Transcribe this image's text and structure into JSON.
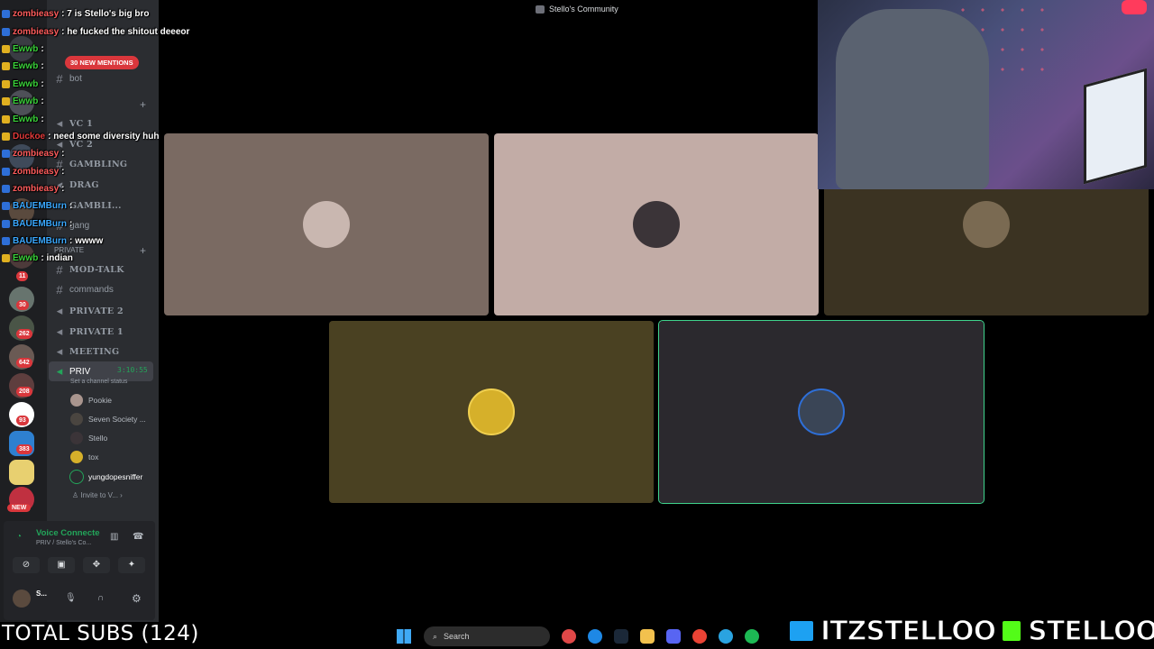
{
  "window": {
    "title": "Stello's Community"
  },
  "rail": {
    "badges": [
      "11",
      "30",
      "262",
      "642",
      "208",
      "93",
      "383"
    ],
    "new_label": "NEW"
  },
  "sidebar": {
    "mentions_pill": "30 NEW MENTIONS",
    "channels": [
      {
        "label": "bot",
        "type": "text",
        "bold": false
      },
      {
        "label": "VC 1",
        "type": "voice",
        "bold": true
      },
      {
        "label": "VC 2",
        "type": "voice",
        "bold": true
      },
      {
        "label": "GAMBLING",
        "type": "text",
        "bold": true
      },
      {
        "label": "DRAG",
        "type": "voice",
        "bold": true
      },
      {
        "label": "GAMBLI...",
        "type": "voice",
        "bold": true
      },
      {
        "label": "gang",
        "type": "text",
        "bold": false
      },
      {
        "label": "PRIVATE",
        "type": "category",
        "bold": false
      },
      {
        "label": "MOD-TALK",
        "type": "text",
        "bold": true
      },
      {
        "label": "commands",
        "type": "text",
        "bold": false
      },
      {
        "label": "PRIVATE 2",
        "type": "voice",
        "bold": true
      },
      {
        "label": "PRIVATE 1",
        "type": "voice",
        "bold": true
      },
      {
        "label": "MEETING",
        "type": "voice",
        "bold": true
      }
    ],
    "active_channel": {
      "label": "PRIV",
      "timer": "3:10:55",
      "status": "Set a channel status"
    },
    "voice_members": [
      "Pookie",
      "Seven Society ...",
      "Stello",
      "tox",
      "yungdopesniffer"
    ],
    "invite_label": "Invite to V..."
  },
  "voice_panel": {
    "title": "Voice Connecte",
    "subtitle": "PRIV / Stello's Co...",
    "user_name": "S..."
  },
  "chat": [
    {
      "user": "zombieasy",
      "msg": " : 7 is Stello's big bro",
      "color": "#ff5c5c",
      "badge": "#2e6fd8"
    },
    {
      "user": "zombieasy",
      "msg": " : he fucked the shitout deeeor",
      "color": "#ff5c5c",
      "badge": "#2e6fd8"
    },
    {
      "user": "Ewwb",
      "msg": " :",
      "color": "#3ad13a",
      "badge": "#e0b020"
    },
    {
      "user": "Ewwb",
      "msg": " :",
      "color": "#3ad13a",
      "badge": "#e0b020"
    },
    {
      "user": "Ewwb",
      "msg": " :",
      "color": "#3ad13a",
      "badge": "#e0b020"
    },
    {
      "user": "Ewwb",
      "msg": " :",
      "color": "#3ad13a",
      "badge": "#e0b020"
    },
    {
      "user": "Ewwb",
      "msg": " :",
      "color": "#3ad13a",
      "badge": "#e0b020"
    },
    {
      "user": "Duckoe",
      "msg": " : need some diversity huh",
      "color": "#e23a3a",
      "badge": "#e0b020"
    },
    {
      "user": "zombieasy",
      "msg": " :",
      "color": "#ff5c5c",
      "badge": "#2e6fd8"
    },
    {
      "user": "zombieasy",
      "msg": " :",
      "color": "#ff5c5c",
      "badge": "#2e6fd8"
    },
    {
      "user": "zombieasy",
      "msg": " :",
      "color": "#ff5c5c",
      "badge": "#2e6fd8"
    },
    {
      "user": "BAUEMBurn",
      "msg": " :",
      "color": "#3aa8ff",
      "badge": "#2e6fd8"
    },
    {
      "user": "BAUEMBurn",
      "msg": " :",
      "color": "#3aa8ff",
      "badge": "#2e6fd8"
    },
    {
      "user": "BAUEMBurn",
      "msg": " : wwww",
      "color": "#3aa8ff",
      "badge": "#2e6fd8"
    },
    {
      "user": "Ewwb",
      "msg": " : indian",
      "color": "#3ad13a",
      "badge": "#e0b020"
    }
  ],
  "tiles": [
    {
      "name": "tile-cat",
      "bg": "#7a6a62",
      "avatar": "#c9b7b0"
    },
    {
      "name": "tile-pink",
      "bg": "#c2aca6",
      "avatar": "#3b3438"
    },
    {
      "name": "tile-brown",
      "bg": "#3b3322",
      "avatar": "#7a6a52"
    },
    {
      "name": "tile-olive",
      "bg": "#4a4122",
      "avatar": "#d6b02a"
    },
    {
      "name": "tile-dark",
      "bg": "#2b292e",
      "avatar": "#3a4556"
    }
  ],
  "stream": {
    "total_subs": "TOTAL SUBS (124)",
    "twitter": "ITZSTELLOO",
    "kick": "STELLOOO"
  },
  "taskbar": {
    "search": "Search"
  },
  "colors": {
    "accent_green": "#23a55a",
    "mention_red": "#da373c",
    "speaking_outline": "#3fd38c"
  }
}
